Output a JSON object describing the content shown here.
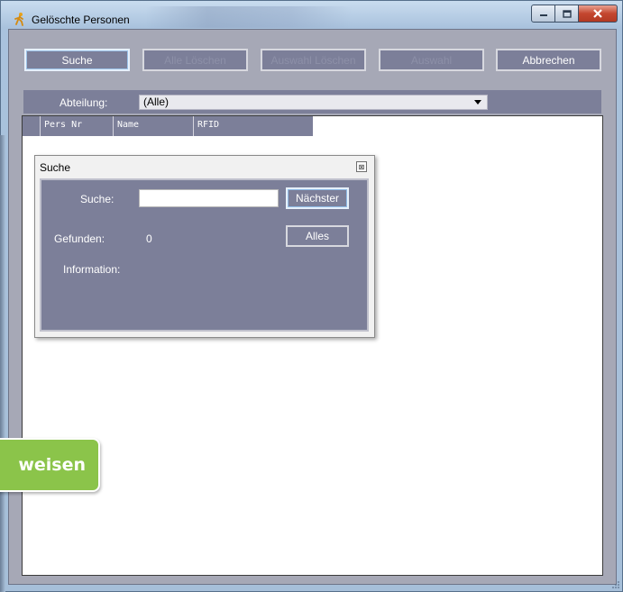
{
  "window": {
    "title": "Gelöschte Personen",
    "controls": {
      "minimize": "–",
      "maximize": "▫",
      "close": "✕"
    }
  },
  "toolbar": {
    "buttons": [
      {
        "label": "Suche",
        "state": "active"
      },
      {
        "label": "Alle Löschen",
        "state": "disabled"
      },
      {
        "label": "Auswahl Löschen",
        "state": "disabled"
      },
      {
        "label": "Auswahl",
        "state": "disabled"
      },
      {
        "label": "Abbrechen",
        "state": "enabled"
      }
    ]
  },
  "filter": {
    "label": "Abteilung:",
    "selected": "(Alle)"
  },
  "grid": {
    "columns": [
      "Pers Nr",
      "Name",
      "RFID"
    ]
  },
  "search_dialog": {
    "title": "Suche",
    "close_glyph": "⊠",
    "search_label": "Suche:",
    "search_value": "",
    "next_button": "Nächster",
    "all_button": "Alles",
    "found_label": "Gefunden:",
    "found_count": "0",
    "information_label": "Information:"
  },
  "badge": {
    "text": "weisen"
  },
  "colors": {
    "panel": "#7c7f99",
    "client": "#a6a8b6",
    "badge": "#8bc44a",
    "close_button": "#c4462f"
  }
}
